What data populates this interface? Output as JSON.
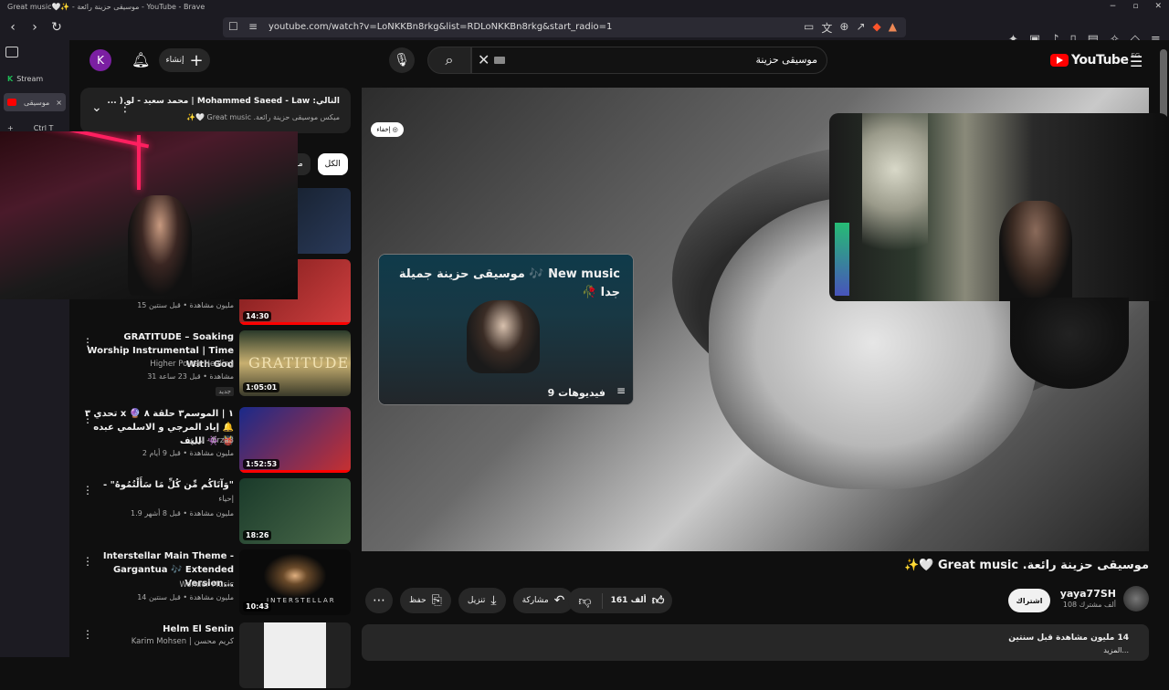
{
  "browser": {
    "window_title": "Great music🤍✨ - موسيقى حزينة رائعة - YouTube - Brave",
    "url": "youtube.com/watch?v=LoNKKBn8rkg&list=RDLoNKKBn8rkg&start_radio=1"
  },
  "sidebar_tabs": [
    {
      "label": "Stream",
      "prefix": "K"
    },
    {
      "label": "موسيقى",
      "close": "×"
    },
    {
      "label": "Ctrl T",
      "prefix": "+"
    }
  ],
  "header": {
    "avatar_letter": "K",
    "create_label": "إنشاء",
    "search_query": "موسيقى حزينة",
    "logo_text": "YouTube",
    "region": "EG"
  },
  "player": {
    "hide_chip": "إخفاء",
    "playlist_card": {
      "title": "New music 🎶 موسيقى حزينة جميلة جدا 🥀",
      "count": "9 فيديوهات"
    }
  },
  "up_next": {
    "label": "التالي: Mohammed Saeed - Law | محمد سعيد - لو ( ...",
    "sub": "ميكس موسيقى حزينة رائعة. Great music 🤍✨"
  },
  "chips": {
    "all": "الكل",
    "from": "من"
  },
  "recommendations": [
    {
      "title": "",
      "channel": "",
      "meta": "15 مليون مشاهدة • قبل سنتين",
      "duration": "14:30",
      "colors": [
        "#7a1a1a",
        "#d04040"
      ]
    },
    {
      "title": "GRATITUDE – Soaking Worship Instrumental | Time With God",
      "channel": "Higher Power Healing",
      "meta": "31 مشاهدة • قبل 23 ساعة",
      "new": "جديد",
      "duration": "1:05:01",
      "colors": [
        "#3a4a2a",
        "#c8b070"
      ]
    },
    {
      "title": "تحدي ٣ x ١ | الموسم٣ حلقة ٨ 🔮 🔔 إياد المرجي و الاسلمي عبده اللبف 👾 👹",
      "channel": "ارزع - Erza3",
      "meta": "2 مليون مشاهدة • قبل 9 أيام",
      "duration": "1:52:53",
      "colors": [
        "#1a2a8a",
        "#c83030"
      ]
    },
    {
      "title": "- \"وَآتَاكُم مِّن كُلِّ مَا سَأَلْتُمُوهُ\"",
      "channel": "إحياء",
      "meta": "1.9 مليون مشاهدة • قبل 8 أشهر",
      "duration": "18:26",
      "colors": [
        "#1a3a2a",
        "#4a6a4a"
      ]
    },
    {
      "title": "Interstellar Main Theme - Gargantua 🎶 Extended Version...",
      "channel": "Wonder Music",
      "meta": "14 مليون مشاهدة • قبل سنتين",
      "duration": "10:43",
      "colors": [
        "#0a0a0a",
        "#6a5a4a"
      ]
    },
    {
      "title": "Helm El Senin",
      "channel": "Karim Mohsen | كريم محسن",
      "meta": "",
      "duration": "",
      "colors": [
        "#222222",
        "#eeeeee"
      ]
    }
  ],
  "video": {
    "title": "موسيقى حزينة رائعة. Great music 🤍✨",
    "channel_name": "yaya77SH",
    "subscribers": "108 ألف مشترك",
    "subscribe_label": "اشتراك",
    "likes": "161 ألف",
    "share_label": "مشاركة",
    "download_label": "تنزيل",
    "save_label": "حفظ",
    "views": "14 مليون مشاهدة  قبل سنتين",
    "more_label": "...المزيد"
  }
}
